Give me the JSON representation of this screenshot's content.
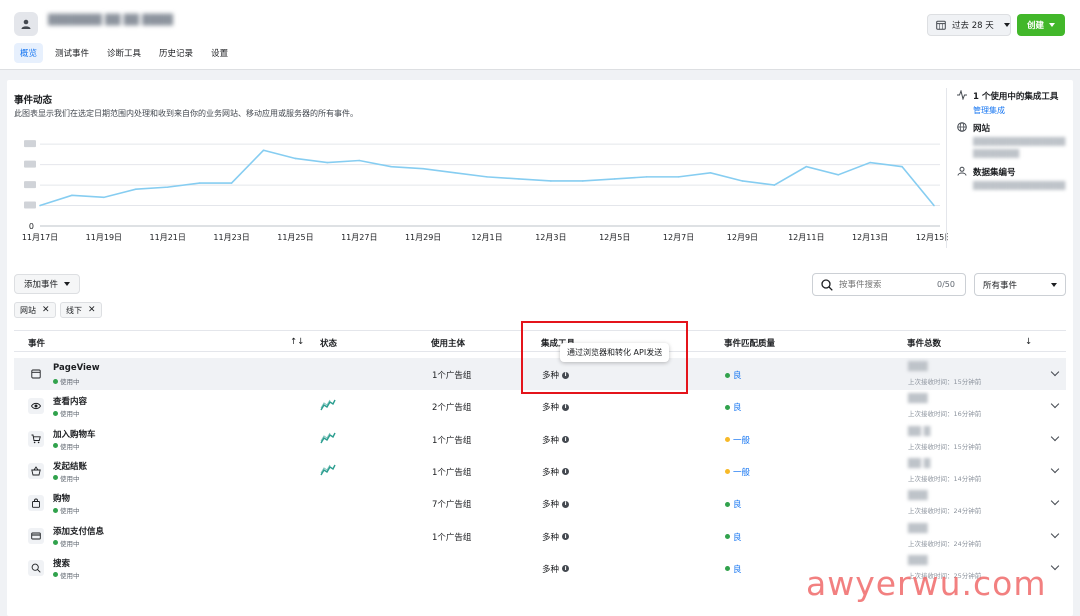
{
  "header": {
    "dataset_title": "███████ ██ ██ ████",
    "tabs": [
      {
        "label": "概览",
        "active": true
      },
      {
        "label": "测试事件",
        "active": false
      },
      {
        "label": "诊断工具",
        "active": false
      },
      {
        "label": "历史记录",
        "active": false
      },
      {
        "label": "设置",
        "active": false
      }
    ],
    "date_range": "过去 28 天",
    "create_label": "创建"
  },
  "activity": {
    "title": "事件动态",
    "description": "此图表显示我们在选定日期范围内处理和收到来自你的业务网站、移动应用或服务器的所有事件。"
  },
  "chart_data": {
    "type": "line",
    "title": "",
    "x": [
      "11月17日",
      "11月18日",
      "11月19日",
      "11月20日",
      "11月21日",
      "11月22日",
      "11月23日",
      "11月24日",
      "11月25日",
      "11月26日",
      "11月27日",
      "11月28日",
      "11月29日",
      "11月30日",
      "12月1日",
      "12月2日",
      "12月3日",
      "12月4日",
      "12月5日",
      "12月6日",
      "12月7日",
      "12月8日",
      "12月9日",
      "12月10日",
      "12月11日",
      "12月12日",
      "12月13日",
      "12月14日",
      "12月15日"
    ],
    "x_tick_labels": [
      "11月17日",
      "11月19日",
      "11月21日",
      "11月23日",
      "11月25日",
      "11月27日",
      "11月29日",
      "12月1日",
      "12月3日",
      "12月5日",
      "12月7日",
      "12月9日",
      "12月11日",
      "12月13日",
      "12月15日"
    ],
    "series": [
      {
        "values": [
          1.0,
          1.5,
          1.4,
          1.8,
          1.9,
          2.1,
          2.1,
          3.7,
          3.3,
          3.1,
          3.2,
          2.9,
          2.8,
          2.6,
          2.4,
          2.3,
          2.2,
          2.2,
          2.3,
          2.4,
          2.4,
          2.6,
          2.2,
          2.0,
          2.9,
          2.5,
          3.1,
          2.9,
          1.0
        ],
        "color": "#86cdf1"
      }
    ],
    "y_tick_labels": [
      "0"
    ],
    "y_ticks": [
      0,
      1,
      2,
      3,
      4
    ],
    "ylim": [
      0,
      4.3
    ],
    "grid": true,
    "legend": "none"
  },
  "side_panel": {
    "integrations_title": "1 个使用中的集成工具",
    "manage_link": "管理集成",
    "website_label": "网站",
    "website_value": "████████████████",
    "website_value2": "████████",
    "dataset_id_label": "数据集编号",
    "dataset_id_value": "████████████████"
  },
  "controls": {
    "add_event_label": "添加事件",
    "chips": [
      "网站",
      "线下"
    ],
    "search_placeholder": "按事件搜索",
    "search_count": "0/50",
    "filter_value": "所有事件"
  },
  "table": {
    "headers": {
      "event": "事件",
      "status": "状态",
      "owner": "使用主体",
      "integration": "集成工具",
      "quality": "事件匹配质量",
      "total": "事件总数"
    },
    "tooltip": "通过浏览器和转化 API发送",
    "rows": [
      {
        "icon": "browser-window-icon",
        "name": "PageView",
        "status": "使用中",
        "trend": false,
        "owner": "1个广告组",
        "integration": "多种",
        "quality": "良",
        "quality_color": "#31a24c",
        "total": "███",
        "last_received": "上次接收时间：15分钟前"
      },
      {
        "icon": "eye-icon",
        "name": "查看内容",
        "status": "使用中",
        "trend": true,
        "owner": "2个广告组",
        "integration": "多种",
        "quality": "良",
        "quality_color": "#31a24c",
        "total": "███",
        "last_received": "上次接收时间：16分钟前"
      },
      {
        "icon": "cart-icon",
        "name": "加入购物车",
        "status": "使用中",
        "trend": true,
        "owner": "1个广告组",
        "integration": "多种",
        "quality": "一般",
        "quality_color": "#f7b928",
        "total": "██ █",
        "last_received": "上次接收时间：15分钟前"
      },
      {
        "icon": "basket-icon",
        "name": "发起结账",
        "status": "使用中",
        "trend": true,
        "owner": "1个广告组",
        "integration": "多种",
        "quality": "一般",
        "quality_color": "#f7b928",
        "total": "██ █",
        "last_received": "上次接收时间：14分钟前"
      },
      {
        "icon": "shopping-bag-icon",
        "name": "购物",
        "status": "使用中",
        "trend": false,
        "owner": "7个广告组",
        "integration": "多种",
        "quality": "良",
        "quality_color": "#31a24c",
        "total": "███",
        "last_received": "上次接收时间：24分钟前"
      },
      {
        "icon": "credit-card-icon",
        "name": "添加支付信息",
        "status": "使用中",
        "trend": false,
        "owner": "1个广告组",
        "integration": "多种",
        "quality": "良",
        "quality_color": "#31a24c",
        "total": "███",
        "last_received": "上次接收时间：24分钟前"
      },
      {
        "icon": "search-icon",
        "name": "搜索",
        "status": "使用中",
        "trend": false,
        "owner": "",
        "integration": "多种",
        "quality": "良",
        "quality_color": "#31a24c",
        "total": "███",
        "last_received": "上次接收时间：25分钟前"
      }
    ]
  },
  "watermark": "awyerwu.com"
}
